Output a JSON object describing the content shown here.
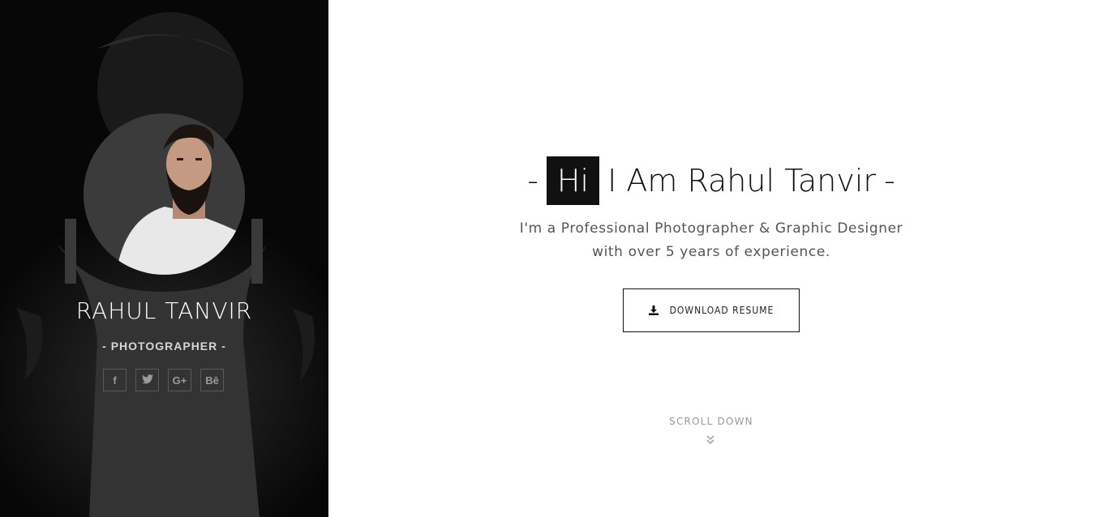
{
  "sidebar": {
    "profile_name": "RAHUL TANVIR",
    "profile_role": "- PHOTOGRAPHER -",
    "social": [
      {
        "icon": "facebook-icon",
        "glyph": "f"
      },
      {
        "icon": "twitter-icon",
        "glyph": "t"
      },
      {
        "icon": "google-plus-icon",
        "glyph": "G+"
      },
      {
        "icon": "behance-icon",
        "glyph": "Bē"
      }
    ]
  },
  "hero": {
    "dash_left": "-",
    "hi": "Hi",
    "title": "I Am Rahul Tanvir",
    "dash_right": "-",
    "description_line1": "I'm a Professional Photographer & Graphic Designer",
    "description_line2": "with over 5 years of experience.",
    "download_label": "DOWNLOAD RESUME",
    "scroll_label": "SCROLL DOWN"
  },
  "colors": {
    "sidebar_bg": "#080808",
    "accent": "#111111",
    "text_muted": "#9a9a9a"
  }
}
